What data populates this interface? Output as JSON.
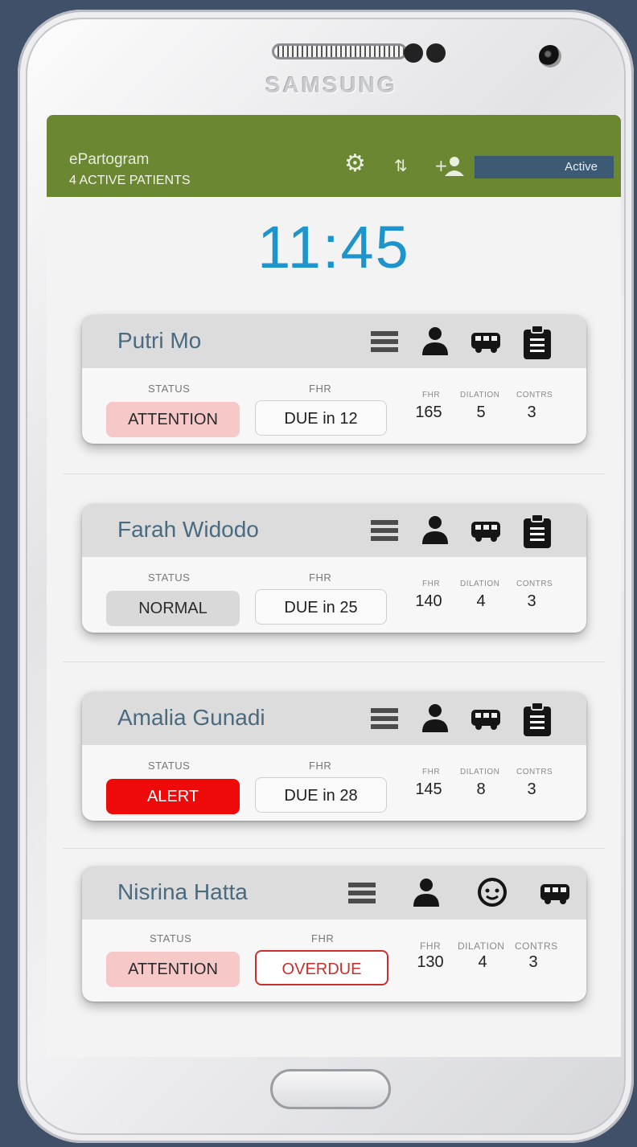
{
  "device": {
    "brand": "SAMSUNG"
  },
  "header": {
    "title": "ePartogram",
    "subtitle": "4 ACTIVE PATIENTS",
    "status": "Active",
    "icons": [
      "gear-icon",
      "sort-icon",
      "add-user-icon"
    ],
    "bg_color": "#6b8732"
  },
  "clock": "11:45",
  "labels": {
    "status": "STATUS",
    "fhr": "FHR",
    "fhr_small": "FHR",
    "dilation": "DILATION",
    "contrs": "CONTRS"
  },
  "patients": [
    {
      "name": "Putri Mo",
      "status": "ATTENTION",
      "fhr_due": "DUE in 12",
      "fhr": "165",
      "dilation": "5",
      "contrs": "3"
    },
    {
      "name": "Farah Widodo",
      "status": "NORMAL",
      "fhr_due": "DUE in 25",
      "fhr": "140",
      "dilation": "4",
      "contrs": "3"
    },
    {
      "name": "Amalia Gunadi",
      "status": "ALERT",
      "fhr_due": "DUE in 28",
      "fhr": "145",
      "dilation": "8",
      "contrs": "3"
    },
    {
      "name": "Nisrina Hatta",
      "status": "ATTENTION",
      "fhr_due": "OVERDUE",
      "fhr": "130",
      "dilation": "4",
      "contrs": "3"
    }
  ],
  "status_colors": {
    "ATTENTION": "#f6c8c8",
    "NORMAL": "#d9d9d9",
    "ALERT": "#ef0a0a"
  }
}
